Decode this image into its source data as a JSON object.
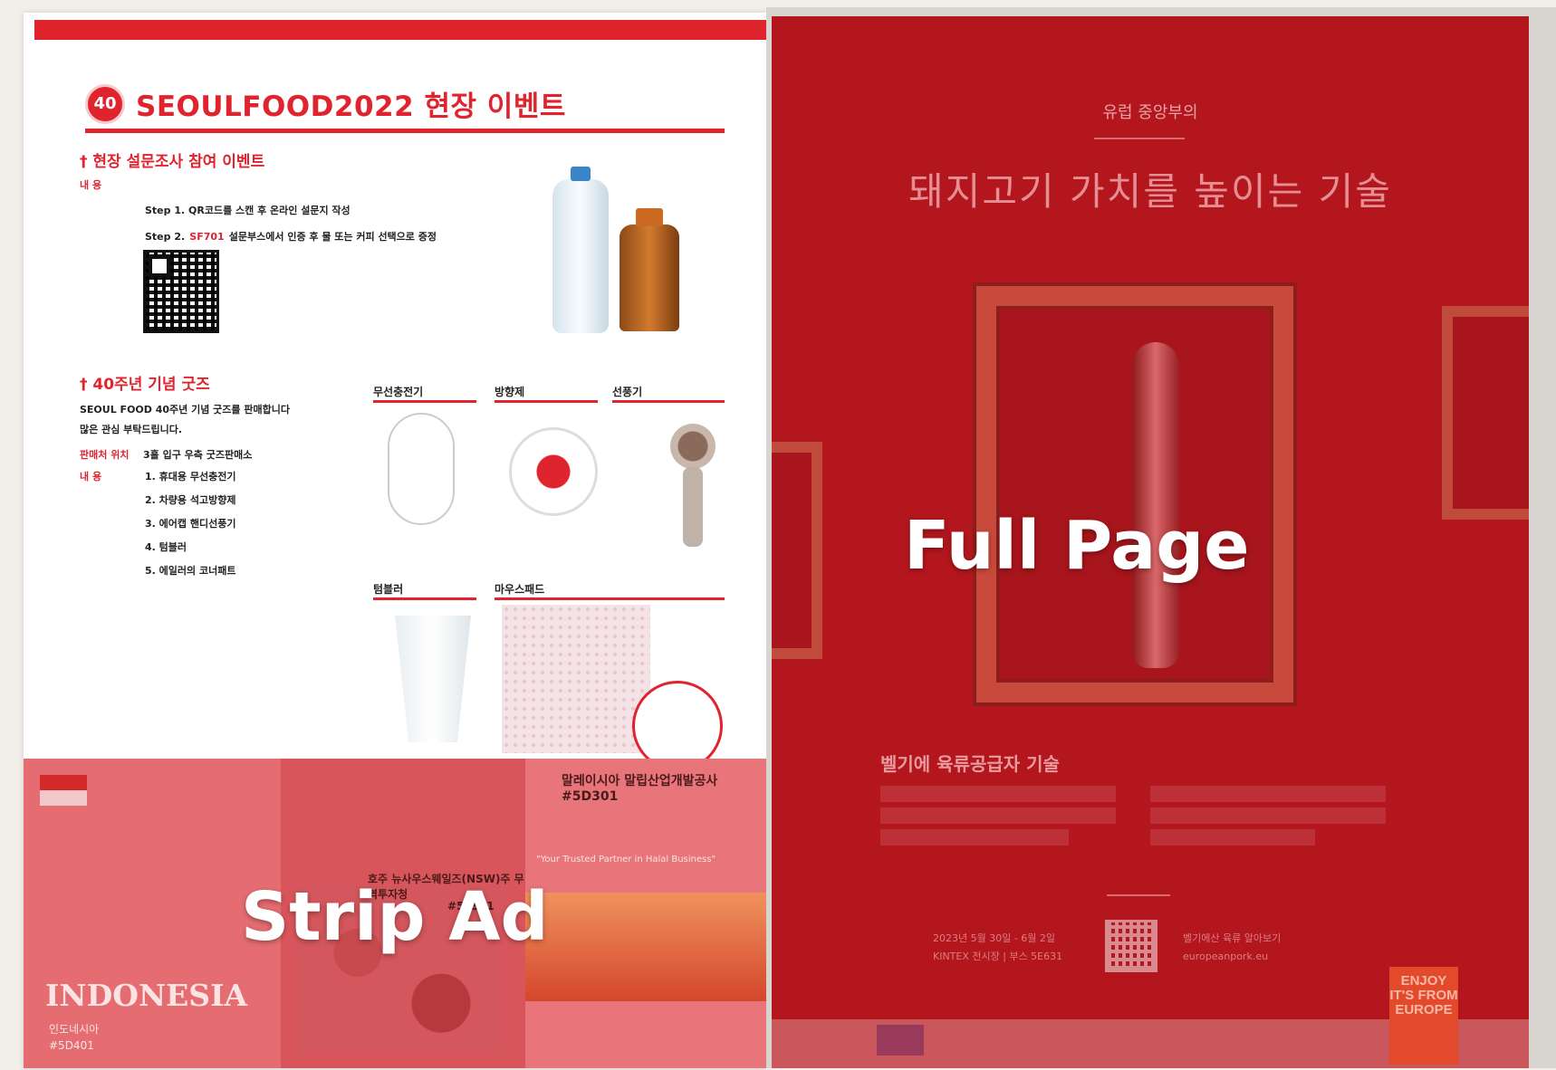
{
  "labels": {
    "full_page": "Full Page",
    "strip_ad": "Strip Ad"
  },
  "left_page": {
    "logo_text": "40",
    "title": "SEOULFOOD2022 현장 이벤트",
    "survey": {
      "title": "† 현장 설문조사 참여 이벤트",
      "content_label": "내    용",
      "step1": "Step 1. QR코드를 스캔 후 온라인 설문지 작성",
      "step2_prefix": "Step 2.",
      "step2_highlight": "SF701",
      "step2_suffix": "설문부스에서 인증 후 물 또는 커피 선택으로 증정"
    },
    "goods": {
      "title": "† 40주년 기념 굿즈",
      "line1": "SEOUL FOOD 40주년 기념 굿즈를 판매합니다",
      "line2": "많은 관심 부탁드립니다.",
      "location_label": "판매처 위치",
      "location_value": "3홀 입구 우측 굿즈판매소",
      "content_label": "내    용",
      "items": [
        "1. 휴대용 무선충전기",
        "2. 차량용 석고방향제",
        "3. 에어캡 핸디선풍기",
        "4. 텀블러",
        "5. 에일러의 코너패트"
      ],
      "headers": [
        "무선충전기",
        "방향제",
        "선풍기",
        "텀블러",
        "마우스패드"
      ]
    }
  },
  "strip_ad": {
    "country": "INDONESIA",
    "country_kr": "인도네시아",
    "booth": "#5D401",
    "malaysia": "말레이시아 말립산업개발공사",
    "malaysia_booth": "#5D301",
    "nsw": "호주 뉴사우스웨일즈(NSW)주 무역투자청",
    "nsw_booth": "#5E301",
    "slogan": "\"Your Trusted Partner in Halal Business\""
  },
  "full_page": {
    "kicker": "유럽 중앙부의",
    "headline": "돼지고기 가치를 높이는 기술",
    "subhead": "벨기에 육류공급자 기술",
    "date": "2023년 5월 30일 - 6월 2일",
    "venue": "KINTEX 전시장 | 부스 5E631",
    "cta": "벨기에산 육류 알아보기",
    "url": "europeanpork.eu",
    "enjoy": "ENJOY IT'S FROM EUROPE"
  }
}
